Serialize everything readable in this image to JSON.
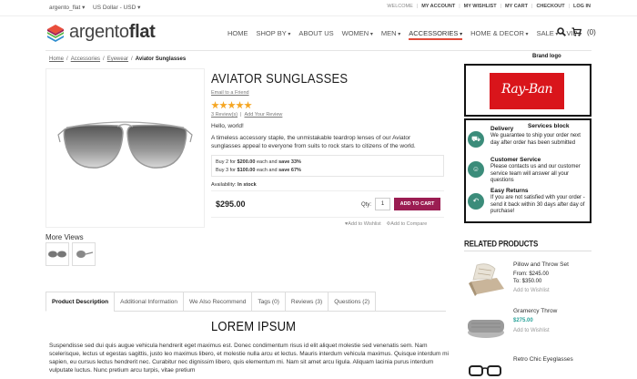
{
  "topbar": {
    "store": "argento_flat",
    "currency": "US Dollar - USD",
    "welcome": "WELCOME",
    "links": [
      "MY ACCOUNT",
      "MY WISHLIST",
      "MY CART",
      "CHECKOUT",
      "LOG IN"
    ]
  },
  "header": {
    "logo_light": "argento",
    "logo_bold": "flat",
    "nav": [
      "HOME",
      "SHOP BY",
      "ABOUT US",
      "WOMEN",
      "MEN",
      "ACCESSORIES",
      "HOME & DECOR",
      "SALE",
      "VIP"
    ],
    "nav_has_caret": [
      false,
      true,
      false,
      true,
      true,
      true,
      true,
      true,
      true
    ],
    "cart_count": "(0)"
  },
  "breadcrumb": [
    "Home",
    "Accessories",
    "Eyewear",
    "Aviator Sunglasses"
  ],
  "product": {
    "name": "AVIATOR SUNGLASSES",
    "email_friend": "Email to a Friend",
    "rating_stars": 5,
    "reviews_link": "3 Review(s)",
    "add_review": "Add Your Review",
    "hello": "Hello, world!",
    "description": "A timeless accessory staple, the unmistakable teardrop lenses of our Aviator sunglasses appeal to everyone from suits to rock stars to citizens of the world.",
    "tier1_pre": "Buy 2 for ",
    "tier1_price": "$200.00",
    "tier1_mid": " each and ",
    "tier1_save": "save 33%",
    "tier2_pre": "Buy 3 for ",
    "tier2_price": "$100.00",
    "tier2_mid": " each and ",
    "tier2_save": "save 67%",
    "availability_label": "Availability:",
    "availability_value": "In stock",
    "price": "$295.00",
    "qty_label": "Qty:",
    "qty_value": "1",
    "add_to_cart": "ADD TO CART",
    "add_wishlist": "Add to Wishlist",
    "add_compare": "Add to Compare",
    "more_views": "More Views"
  },
  "brand": {
    "caption": "Brand logo",
    "logo_text": "Ray-Ban"
  },
  "services": {
    "caption": "Services block",
    "items": [
      {
        "title": "Delivery",
        "text": "We guarantee to ship your order next day after order has been submitted",
        "icon": "truck-icon"
      },
      {
        "title": "Customer Service",
        "text": "Please contacts us and our customer service team will answer all your questions",
        "icon": "support-icon"
      },
      {
        "title": "Easy Returns",
        "text": "If you are not satisfied with your order - send it back within 30 days after day of purchase!",
        "icon": "return-icon"
      }
    ]
  },
  "related": {
    "title": "RELATED PRODUCTS",
    "items": [
      {
        "name": "Pillow and Throw Set",
        "price_from": "From: $245.00",
        "price_to": "To: $350.00",
        "wishlist": "Add to Wishlist"
      },
      {
        "name": "Gramercy Throw",
        "price": "$275.00",
        "wishlist": "Add to Wishlist"
      },
      {
        "name": "Retro Chic Eyeglasses"
      }
    ]
  },
  "tabs": [
    "Product Description",
    "Additional Information",
    "We Also Recommend",
    "Tags (0)",
    "Reviews (3)",
    "Questions (2)"
  ],
  "description_block": {
    "title": "LOREM IPSUM",
    "body": "Suspendisse sed dui quis augue vehicula hendrerit eget maximus est. Donec condimentum risus id elit aliquet molestie sed venenatis sem. Nam scelerisque, lectus ut egestas sagittis, justo leo maximus libero, et molestie nulla arcu et lectus. Mauris interdum vehicula maximus. Quisque interdum mi sapien, eu cursus lectus hendrerit nec. Curabitur nec dignissim libero, quis elementum mi. Nam sit amet arcu ligula. Aliquam lacinia purus interdum vulputate luctus. Nunc pretium arcu turpis, vitae pretium"
  },
  "colors": {
    "accent": "#9b1d52",
    "nav_underline": "#e14b3b",
    "service_icon": "#3b8c7a",
    "teal_price": "#2aa39a",
    "brand_red": "#d9151b"
  }
}
